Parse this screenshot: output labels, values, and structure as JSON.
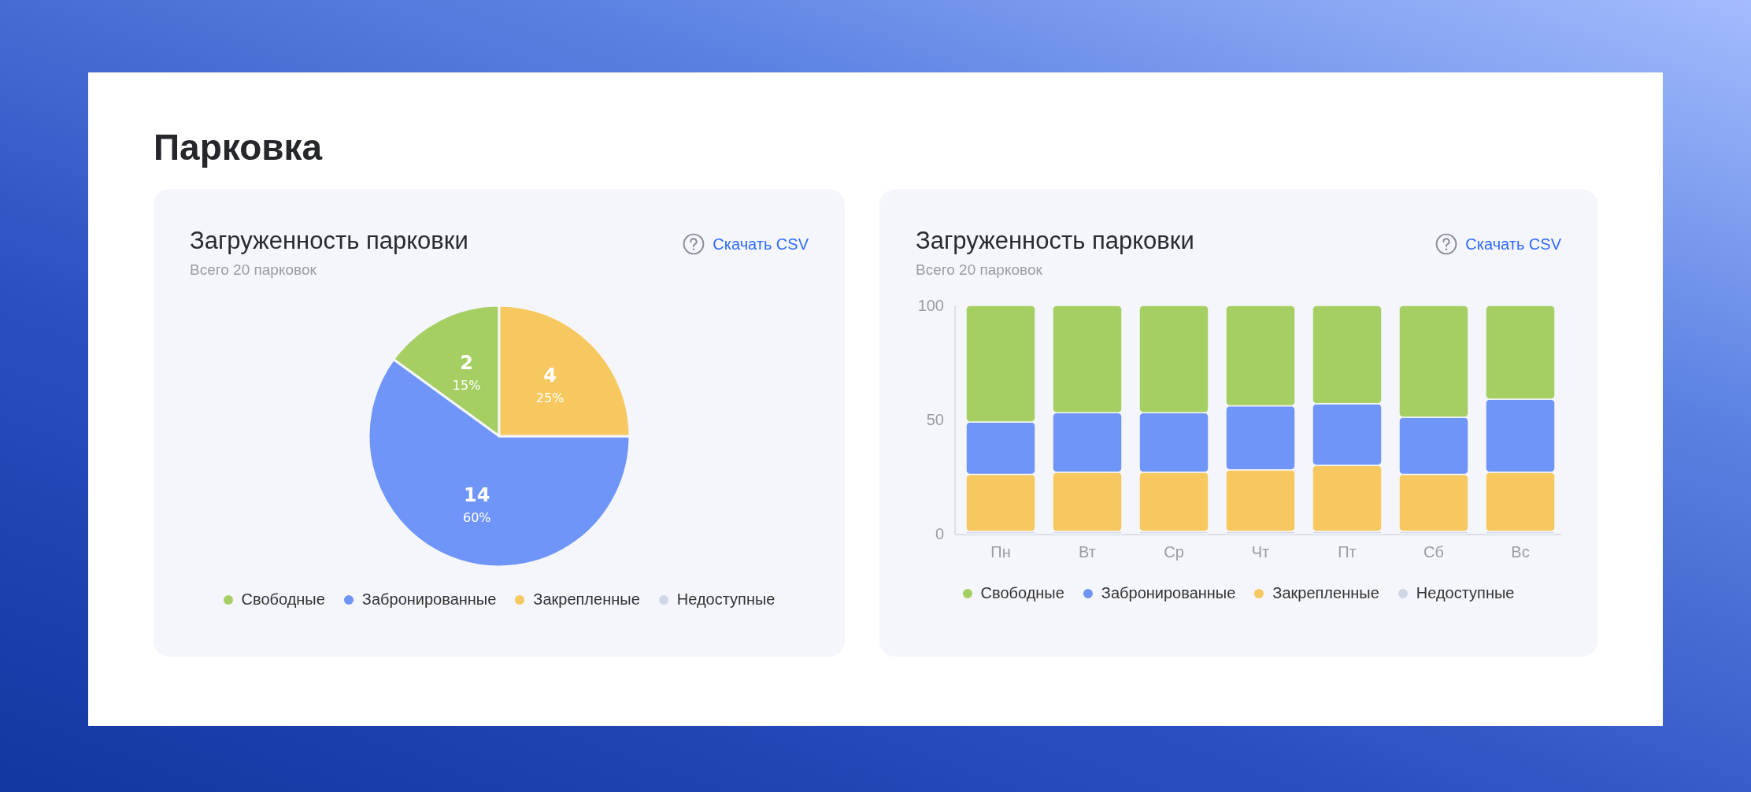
{
  "page": {
    "title": "Парковка"
  },
  "cards": [
    {
      "title": "Загруженность парковки",
      "subtitle": "Всего 20 парковок",
      "link": "Скачать CSV",
      "counts": [
        "2",
        "14",
        "4"
      ],
      "chart_data": {
        "type": "pie",
        "categories": [
          "Свободные",
          "Забронированные",
          "Закрепленные",
          "Недоступные"
        ],
        "colors": [
          "#a5cf63",
          "#6e95f7",
          "#f6c85f",
          "#cfd6e4"
        ],
        "values": [
          15,
          60,
          25,
          0
        ],
        "value_labels": [
          "15%",
          "60%",
          "25%",
          null
        ]
      }
    },
    {
      "title": "Загруженность парковки",
      "subtitle": "Всего 20 парковок",
      "link": "Скачать CSV",
      "chart_data": {
        "type": "bar",
        "stacked": true,
        "categories": [
          "Пн",
          "Вт",
          "Ср",
          "Чт",
          "Пт",
          "Сб",
          "Вс"
        ],
        "ylim": [
          0,
          100
        ],
        "yticks": [
          0,
          50,
          100
        ],
        "series": [
          {
            "name": "Недоступные",
            "color": "#cfd6e4",
            "values": [
              1,
              1,
              1,
              1,
              1,
              1,
              1
            ]
          },
          {
            "name": "Закрепленные",
            "color": "#f6c85f",
            "values": [
              25,
              26,
              26,
              27,
              29,
              25,
              26
            ]
          },
          {
            "name": "Забронированные",
            "color": "#6e95f7",
            "values": [
              23,
              26,
              26,
              28,
              27,
              25,
              32
            ]
          },
          {
            "name": "Свободные",
            "color": "#a5cf63",
            "values": [
              51,
              47,
              47,
              44,
              43,
              49,
              41
            ]
          }
        ]
      }
    }
  ]
}
